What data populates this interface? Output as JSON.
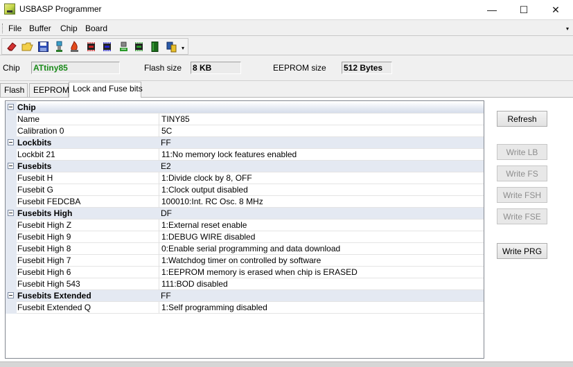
{
  "window": {
    "title": "USBASP Programmer",
    "minimize_glyph": "—",
    "maximize_glyph": "☐",
    "close_glyph": "✕"
  },
  "menu": {
    "items": [
      "File",
      "Buffer",
      "Chip",
      "Board"
    ],
    "overflow_glyph": "▾"
  },
  "toolbar": {
    "icons": [
      "erase-icon",
      "open-icon",
      "save-icon",
      "usb-icon",
      "fire-icon",
      "chip-read-icon",
      "chip-write-icon",
      "chip-verify-icon",
      "chip-fuse-icon",
      "book-icon",
      "chip-select-icon"
    ],
    "dropdown_glyph": "▾"
  },
  "info": {
    "chip_label": "Chip",
    "chip_value": "ATtiny85",
    "chip_color": "#1a8a1a",
    "flash_label": "Flash size",
    "flash_value": "8 KB",
    "eeprom_label": "EEPROM size",
    "eeprom_value": "512 Bytes"
  },
  "tabs": [
    "Flash",
    "EEPROM",
    "Lock and Fuse bits"
  ],
  "active_tab": "Lock and Fuse bits",
  "grid": {
    "rows": [
      {
        "type": "category",
        "name": "Chip",
        "value": ""
      },
      {
        "type": "prop",
        "name": "Name",
        "value": "TINY85"
      },
      {
        "type": "prop",
        "name": "Calibration 0",
        "value": "5C"
      },
      {
        "type": "category",
        "name": "Lockbits",
        "value": "FF"
      },
      {
        "type": "prop",
        "name": "Lockbit 21",
        "value": "11:No memory lock features enabled"
      },
      {
        "type": "category",
        "name": "Fusebits",
        "value": "E2"
      },
      {
        "type": "prop",
        "name": "Fusebit H",
        "value": "1:Divide clock by 8, OFF"
      },
      {
        "type": "prop",
        "name": "Fusebit G",
        "value": "1:Clock output disabled"
      },
      {
        "type": "prop",
        "name": "Fusebit FEDCBA",
        "value": "100010:Int. RC Osc. 8 MHz"
      },
      {
        "type": "category",
        "name": "Fusebits High",
        "value": "DF"
      },
      {
        "type": "prop",
        "name": "Fusebit High Z",
        "value": "1:External reset enable"
      },
      {
        "type": "prop",
        "name": "Fusebit High 9",
        "value": "1:DEBUG WIRE disabled"
      },
      {
        "type": "prop",
        "name": "Fusebit High 8",
        "value": "0:Enable serial programming and data download"
      },
      {
        "type": "prop",
        "name": "Fusebit High 7",
        "value": "1:Watchdog timer on controlled by software"
      },
      {
        "type": "prop",
        "name": "Fusebit High 6",
        "value": "1:EEPROM memory is erased when chip is ERASED"
      },
      {
        "type": "prop",
        "name": "Fusebit High 543",
        "value": "111:BOD disabled"
      },
      {
        "type": "category",
        "name": "Fusebits Extended",
        "value": "FF"
      },
      {
        "type": "prop",
        "name": "Fusebit Extended Q",
        "value": "1:Self programming disabled"
      }
    ]
  },
  "buttons": {
    "refresh": "Refresh",
    "write_lb": "Write LB",
    "write_fs": "Write FS",
    "write_fsh": "Write FSH",
    "write_fse": "Write FSE",
    "write_prg": "Write PRG"
  }
}
